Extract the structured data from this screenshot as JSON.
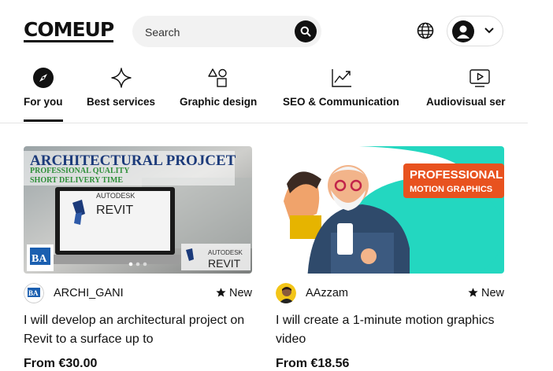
{
  "header": {
    "logo": "COMEUP",
    "search": {
      "placeholder": "Search",
      "value": ""
    }
  },
  "tabs": [
    {
      "label": "For you",
      "icon": "compass-icon",
      "active": true
    },
    {
      "label": "Best services",
      "icon": "sparkle-icon"
    },
    {
      "label": "Graphic design",
      "icon": "shapes-icon"
    },
    {
      "label": "SEO & Communication",
      "icon": "chart-icon"
    },
    {
      "label": "Audiovisual ser",
      "icon": "play-icon"
    }
  ],
  "cards": [
    {
      "image": {
        "headline": "ARCHITECTURAL PROJCET",
        "line1": "PROFESSIONAL QUALITY",
        "line2": "SHORT DELIVERY TIME",
        "brand_top": "AUTODESK",
        "brand_name": "REVIT",
        "logo_text": "BA"
      },
      "seller": "ARCHI_GANI",
      "badge": "New",
      "title": "I will develop an architectural project on Revit to a surface up to",
      "price": "From €30.00"
    },
    {
      "image": {
        "line1": "PROFESSIONAL",
        "line2": "MOTION GRAPHICS"
      },
      "seller": "AAzzam",
      "badge": "New",
      "title": "I will create a 1-minute motion graphics video",
      "price": "From €18.56"
    }
  ]
}
